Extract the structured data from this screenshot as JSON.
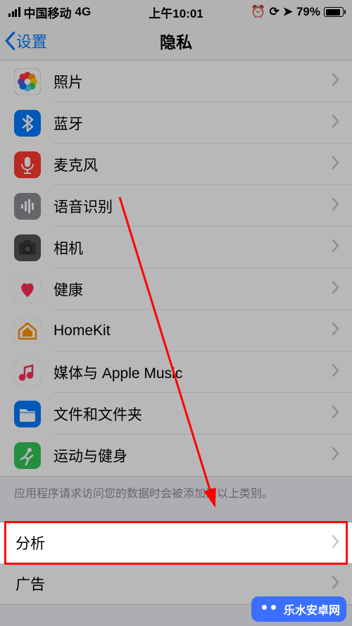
{
  "status": {
    "carrier": "中国移动",
    "network": "4G",
    "time": "上午10:01",
    "battery_pct": "79%",
    "battery_fill_pct": 79
  },
  "nav": {
    "back_label": "设置",
    "title": "隐私"
  },
  "rows": [
    {
      "label": "照片",
      "icon": "photos"
    },
    {
      "label": "蓝牙",
      "icon": "bluetooth"
    },
    {
      "label": "麦克风",
      "icon": "microphone"
    },
    {
      "label": "语音识别",
      "icon": "speech"
    },
    {
      "label": "相机",
      "icon": "camera"
    },
    {
      "label": "健康",
      "icon": "health"
    },
    {
      "label": "HomeKit",
      "icon": "homekit"
    },
    {
      "label": "媒体与 Apple Music",
      "icon": "music"
    },
    {
      "label": "文件和文件夹",
      "icon": "files"
    },
    {
      "label": "运动与健身",
      "icon": "motion"
    }
  ],
  "footer_note": "应用程序请求访问您的数据时会被添加到以上类别。",
  "rows2": [
    {
      "label": "分析"
    },
    {
      "label": "广告"
    }
  ],
  "brand": "乐水安卓网"
}
